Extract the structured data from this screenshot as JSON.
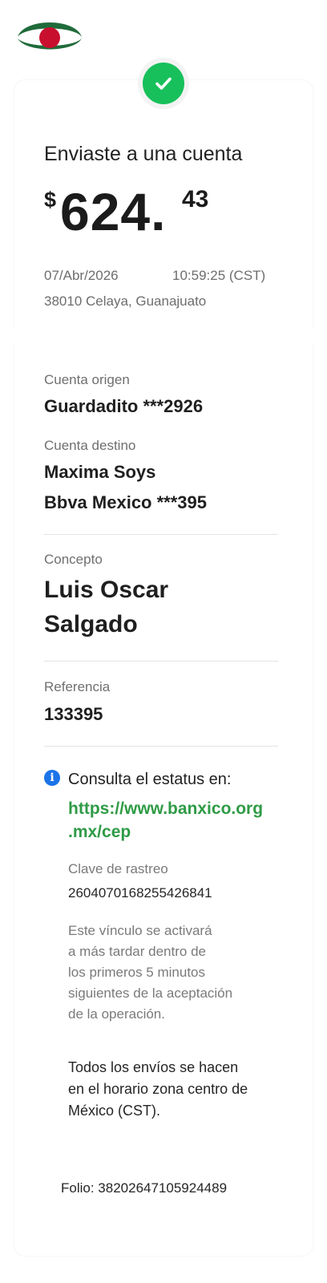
{
  "header": {
    "logo_icon": "bank-logo-icon",
    "status_icon": "check-circle-icon",
    "brand_colors": {
      "green": "#1f6b3a",
      "red": "#c8102e",
      "success": "#17c05b"
    }
  },
  "receipt": {
    "headline": "Enviaste a una cuenta",
    "currency": "$",
    "amount_main": "624.",
    "amount_cents": "43",
    "date": "07/Abr/2026",
    "time": "10:59:25 (CST)",
    "location": "38010 Celaya, Guanajuato"
  },
  "details": {
    "origin_label": "Cuenta origen",
    "origin_value": "Guardadito ***2926",
    "dest_label": "Cuenta destino",
    "dest_name": "Maxima Soys",
    "dest_bank": "Bbva Mexico ***395",
    "concept_label": "Concepto",
    "concept_line1": "Luis Oscar",
    "concept_line2": "Salgado",
    "reference_label": "Referencia",
    "reference_value": "133395"
  },
  "status_info": {
    "info_icon": "info-icon",
    "intro": "Consulta el estatus en:",
    "link_line1": "https://www.banxico.org",
    "link_line2": ".mx/cep",
    "tracking_label": "Clave de rastreo",
    "tracking_value": "2604070168255426841",
    "note_lines": [
      "Este vínculo se activará",
      "a más tardar dentro de",
      "los primeros 5 minutos",
      "siguientes de la aceptación",
      "de la operación."
    ],
    "hours_lines": [
      "Todos los envíos se hacen",
      "en el horario zona centro de",
      "México (CST)."
    ]
  },
  "footer": {
    "folio": "Folio: 38202647105924489"
  }
}
